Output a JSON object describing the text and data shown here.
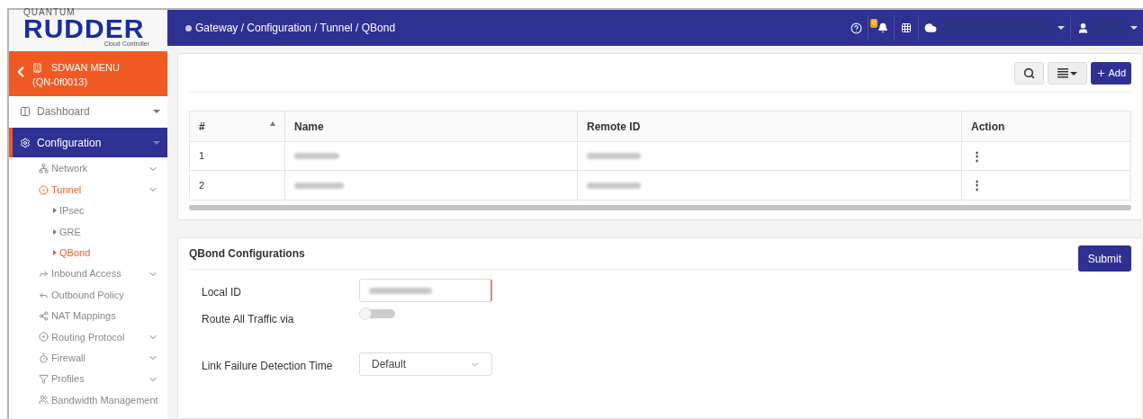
{
  "logo": {
    "top": "QUANTUM",
    "main": "RUDDER",
    "sub": "Cloud Controller"
  },
  "device_menu": {
    "title": "SDWAN MENU",
    "id": "(QN-0f0013)"
  },
  "sidebar": {
    "items": [
      {
        "label": "Dashboard",
        "selected": false,
        "expanded": false,
        "expandable": true
      },
      {
        "label": "Configuration",
        "selected": true,
        "expanded": true,
        "expandable": true,
        "children": [
          {
            "label": "Network",
            "selected": false,
            "expandable": true
          },
          {
            "label": "Tunnel",
            "selected": true,
            "expandable": true,
            "children": [
              {
                "label": "IPsec",
                "selected": false
              },
              {
                "label": "GRE",
                "selected": false
              },
              {
                "label": "QBond",
                "selected": true
              }
            ]
          },
          {
            "label": "Inbound Access",
            "selected": false,
            "expandable": true
          },
          {
            "label": "Outbound Policy",
            "selected": false,
            "expandable": false
          },
          {
            "label": "NAT Mappings",
            "selected": false,
            "expandable": false
          },
          {
            "label": "Routing Protocol",
            "selected": false,
            "expandable": true
          },
          {
            "label": "Firewall",
            "selected": false,
            "expandable": true
          },
          {
            "label": "Profiles",
            "selected": false,
            "expandable": true
          },
          {
            "label": "Bandwidth Management",
            "selected": false,
            "expandable": false
          }
        ]
      }
    ]
  },
  "breadcrumb": "Gateway / Configuration / Tunnel / QBond",
  "header": {
    "notification_count": "0"
  },
  "toolbar": {
    "add_label": "Add"
  },
  "table": {
    "columns": [
      "#",
      "Name",
      "Remote ID",
      "Action"
    ],
    "rows": [
      {
        "index": "1",
        "action": "⋮"
      },
      {
        "index": "2",
        "action": "⋮"
      }
    ]
  },
  "form": {
    "title": "QBond Configurations",
    "submit": "Submit",
    "fields": [
      {
        "kind": "text",
        "label": "Local ID",
        "invalid": true
      },
      {
        "kind": "toggle",
        "label": "Route All Traffic via",
        "on": false
      },
      {
        "kind": "select",
        "label": "Link Failure Detection Time",
        "value": "Default"
      }
    ]
  }
}
